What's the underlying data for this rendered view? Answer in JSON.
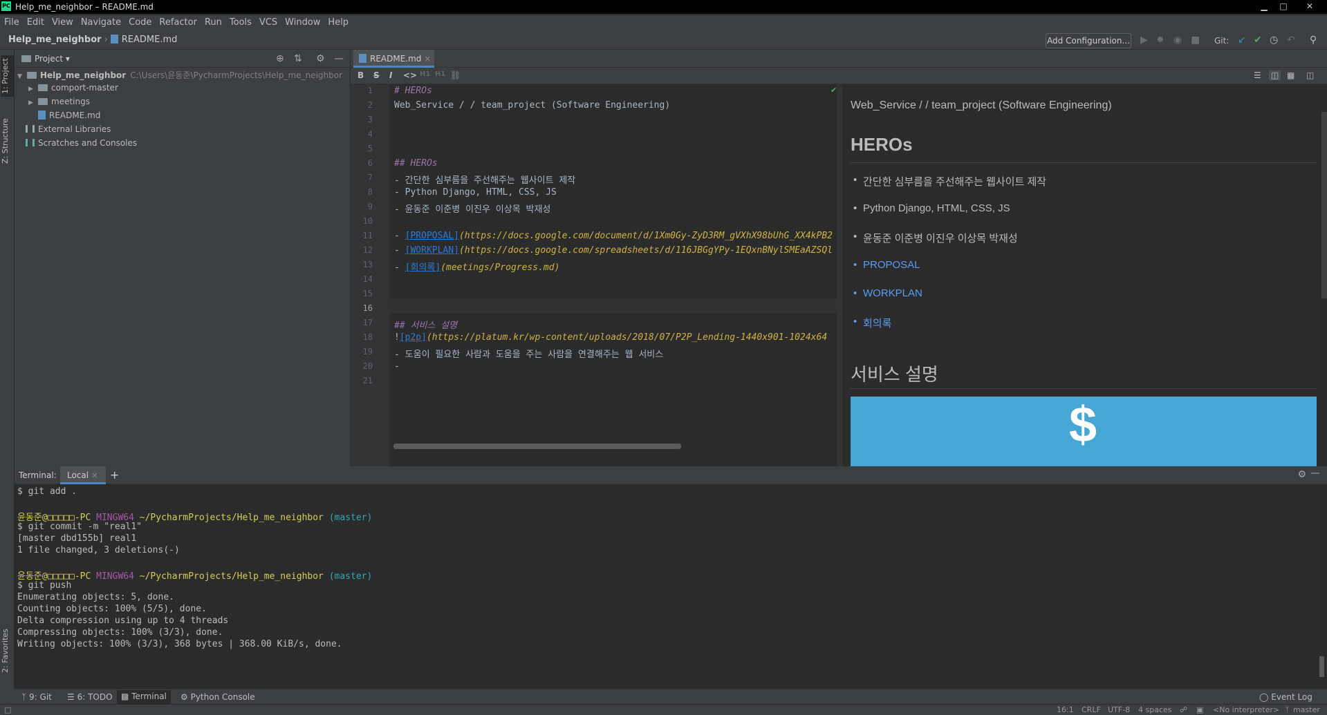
{
  "window": {
    "title": "Help_me_neighbor – README.md",
    "logo": "PC",
    "btn_min": "▁",
    "btn_max": "□",
    "btn_close": "✕"
  },
  "menu": [
    "File",
    "Edit",
    "View",
    "Navigate",
    "Code",
    "Refactor",
    "Run",
    "Tools",
    "VCS",
    "Window",
    "Help"
  ],
  "breadcrumb": {
    "project": "Help_me_neighbor",
    "file": "README.md",
    "sep": "›"
  },
  "toolbar": {
    "add_config": "Add Configuration...",
    "git_label": "Git:"
  },
  "side_tabs": {
    "project": "1: Project",
    "structure": "Z: Structure",
    "favorites": "2: Favorites"
  },
  "project_pane": {
    "title": "Project",
    "dropdown_glyph": "▾",
    "root": {
      "name": "Help_me_neighbor",
      "path": "C:\\Users\\윤동준\\PycharmProjects\\Help_me_neighbor"
    },
    "items": [
      "comport-master",
      "meetings",
      "README.md",
      "External Libraries",
      "Scratches and Consoles"
    ]
  },
  "editor": {
    "tab": "README.md",
    "tab_close": "×",
    "format_buttons": [
      "B",
      "S",
      "I",
      "<>",
      "H1",
      "H1",
      "⛓"
    ],
    "line_numbers": [
      "1",
      "2",
      "3",
      "4",
      "5",
      "6",
      "7",
      "8",
      "9",
      "10",
      "11",
      "12",
      "13",
      "14",
      "15",
      "16",
      "17",
      "18",
      "19",
      "20",
      "21"
    ],
    "lines": {
      "l1": "# HEROs",
      "l2": "Web_Service / / team_project (Software Engineering)",
      "l6": "## HEROs",
      "l7": "- 간단한 심부름을 주선해주는 웹사이트 제작",
      "l8": "- Python Django, HTML, CSS, JS",
      "l9": "- 윤동준 이준병 이진우 이상목 박재성",
      "dash": "- ",
      "l11_link": "[PROPOSAL]",
      "l11_url": "(https://docs.google.com/document/d/1Xm0Gy-ZyD3RM_gVXhX98bUhG_XX4kPB2",
      "l12_link": "[WORKPLAN]",
      "l12_url": "(https://docs.google.com/spreadsheets/d/116JBGgYPy-1EQxnBNylSMEaAZSQl",
      "l13_link": "[회의록]",
      "l13_url": "(meetings/Progress.md)",
      "l17": "## 서비스 설명",
      "l18_bang": "!",
      "l18_link": "[p2p]",
      "l18_url": "(https://platum.kr/wp-content/uploads/2018/07/P2P_Lending-1440x901-1024x64",
      "l19": "- 도움이 필요한 사람과 도움을 주는 사람을 연결해주는 웹 서비스",
      "l20": "-"
    }
  },
  "preview": {
    "intro": "Web_Service / / team_project (Software Engineering)",
    "heading": "HEROs",
    "bullets": [
      "간단한 심부름을 주선해주는 웹사이트 제작",
      "Python Django, HTML, CSS, JS",
      "윤동준 이준병 이진우 이상목 박재성"
    ],
    "links": [
      "PROPOSAL",
      "WORKPLAN",
      "회의록"
    ],
    "heading2": "서비스 설명",
    "image_glyph": "$"
  },
  "terminal": {
    "label": "Terminal:",
    "tab": "Local",
    "tab_close": "×",
    "plus": "+",
    "prompt_user": "윤동준@□□□□□-PC",
    "prompt_env": "MINGW64",
    "prompt_path": "~/PycharmProjects/Help_me_neighbor",
    "prompt_branch": "(master)",
    "lines": {
      "t0": "$ git add .",
      "t2": "$ git commit -m \"real1\"",
      "t3": "[master dbd155b] real1",
      "t4": " 1 file changed, 3 deletions(-)",
      "t6": "$ git push",
      "t7": "Enumerating objects: 5, done.",
      "t8": "Counting objects: 100% (5/5), done.",
      "t9": "Delta compression using up to 4 threads",
      "t10": "Compressing objects: 100% (3/3), done.",
      "t11": "Writing objects: 100% (3/3), 368 bytes | 368.00 KiB/s, done."
    }
  },
  "bottom_tools": {
    "git": "9: Git",
    "todo": "6: TODO",
    "terminal": "Terminal",
    "python_console": "Python Console",
    "event_log": "Event Log"
  },
  "status": {
    "position": "16:1",
    "line_sep": "CRLF",
    "encoding": "UTF-8",
    "indent": "4 spaces",
    "interpreter": "<No interpreter>",
    "branch": "master"
  },
  "colors": {
    "accent": "#4a88c7",
    "link": "#589df6",
    "header": "#9876aa",
    "url": "#d0b344",
    "prompt": "#d4cf59",
    "branch": "#30a8b8"
  },
  "icons": [
    "pycharm-logo-icon",
    "folder-icon",
    "markdown-file-icon",
    "library-icon",
    "scratches-icon",
    "gear-icon",
    "locate-icon",
    "collapse-icon",
    "minimize-icon",
    "run-icon",
    "debug-icon",
    "stop-icon",
    "git-update-icon",
    "git-commit-icon",
    "history-icon",
    "rollback-icon",
    "search-icon",
    "check-icon"
  ]
}
